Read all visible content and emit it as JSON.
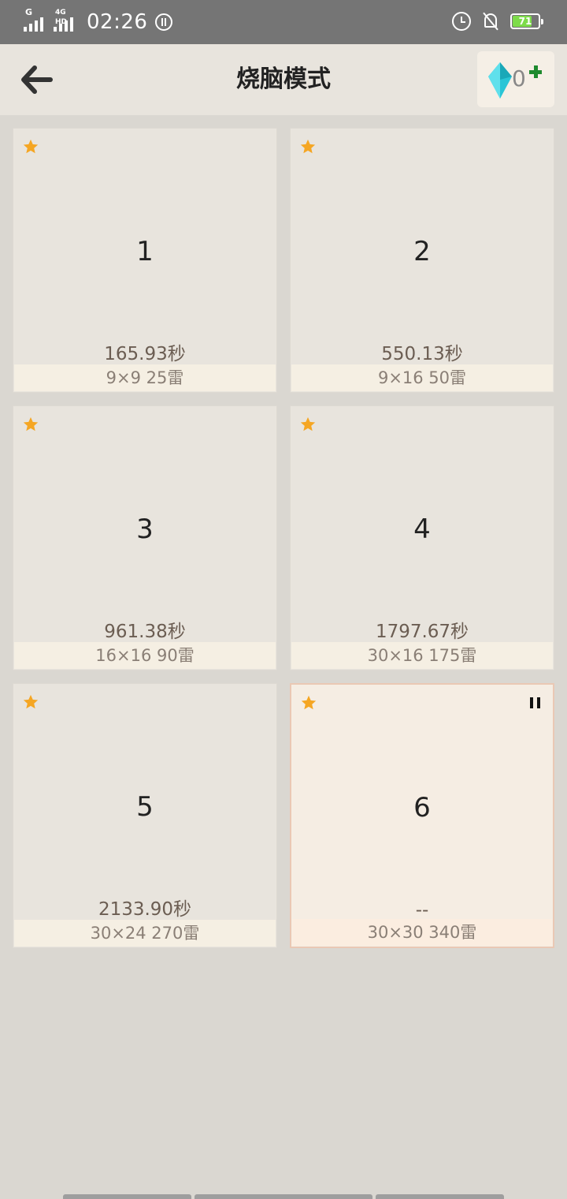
{
  "status_bar": {
    "network1": "G",
    "network2": "4G HD",
    "time": "02:26",
    "battery": "71"
  },
  "header": {
    "title": "烧脑模式",
    "gem_count": "0"
  },
  "levels": [
    {
      "number": "1",
      "record": "165.93秒",
      "spec": "9×9  25雷"
    },
    {
      "number": "2",
      "record": "550.13秒",
      "spec": "9×16  50雷"
    },
    {
      "number": "3",
      "record": "961.38秒",
      "spec": "16×16  90雷"
    },
    {
      "number": "4",
      "record": "1797.67秒",
      "spec": "30×16  175雷"
    },
    {
      "number": "5",
      "record": "2133.90秒",
      "spec": "30×24  270雷"
    },
    {
      "number": "6",
      "record": "--",
      "spec": "30×30  340雷"
    }
  ],
  "colors": {
    "star": "#f5a623",
    "gem": "#29c5d6",
    "plus": "#1e8a2e"
  },
  "icons": [
    "back-arrow-icon",
    "diamond-gem-icon",
    "plus-icon",
    "star-icon",
    "pause-icon",
    "alarm-icon",
    "bell-off-icon",
    "battery-icon"
  ]
}
